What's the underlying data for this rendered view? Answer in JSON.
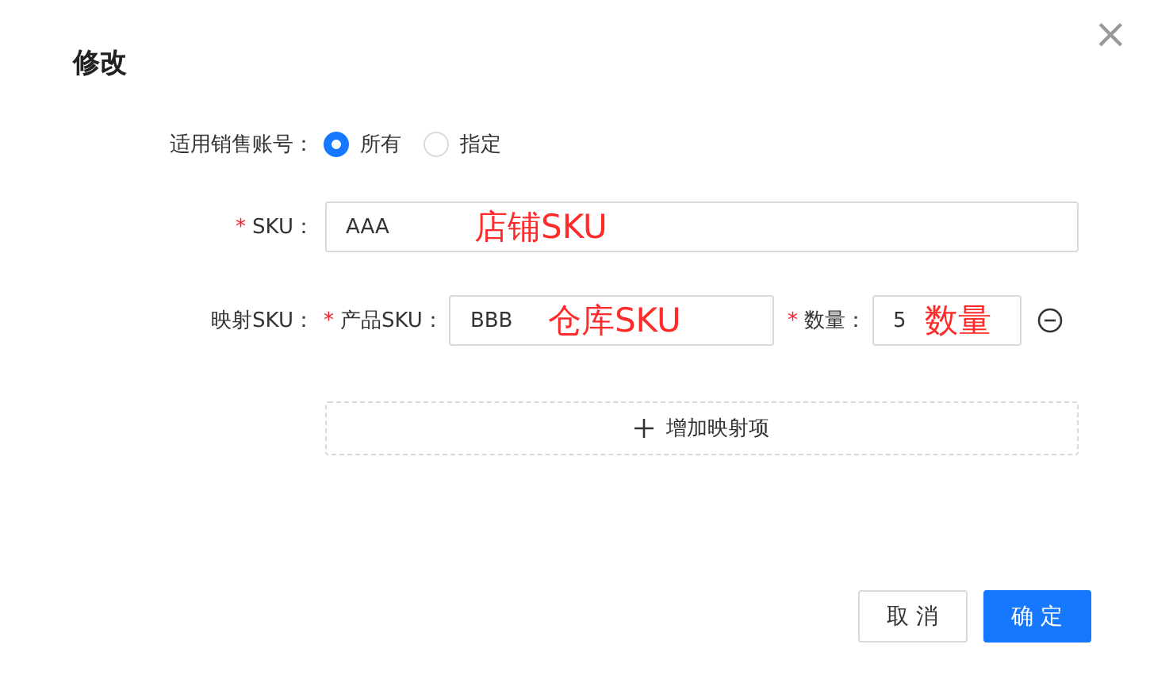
{
  "dialog": {
    "title": "修改",
    "close": "×"
  },
  "account_scope": {
    "label": "适用销售账号：",
    "options": [
      {
        "label": "所有",
        "selected": true
      },
      {
        "label": "指定",
        "selected": false
      }
    ]
  },
  "sku": {
    "required_mark": "*",
    "label": "SKU：",
    "value": "AAA",
    "annotation": "店铺SKU"
  },
  "mapping": {
    "label": "映射SKU：",
    "items": [
      {
        "product_sku": {
          "required_mark": "*",
          "label": "产品SKU：",
          "value": "BBB",
          "annotation": "仓库SKU"
        },
        "quantity": {
          "required_mark": "*",
          "label": "数量：",
          "value": "5",
          "annotation": "数量"
        }
      }
    ],
    "add_label": "增加映射项"
  },
  "buttons": [
    {
      "label": "取 消",
      "kind": "default"
    },
    {
      "label": "确 定",
      "kind": "primary"
    }
  ]
}
